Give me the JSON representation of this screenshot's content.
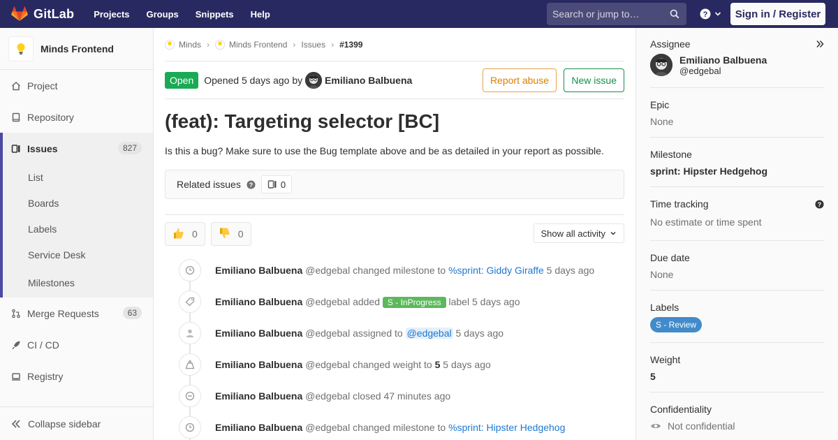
{
  "topbar": {
    "brand": "GitLab",
    "nav": [
      "Projects",
      "Groups",
      "Snippets",
      "Help"
    ],
    "search_placeholder": "Search or jump to…",
    "sign_in": "Sign in / Register",
    "brand_color": "#292961"
  },
  "sidebar": {
    "project_name": "Minds Frontend",
    "items": [
      {
        "label": "Project",
        "icon": "home-icon"
      },
      {
        "label": "Repository",
        "icon": "book-icon"
      },
      {
        "label": "Issues",
        "icon": "issues-icon",
        "badge": "827"
      },
      {
        "label": "Merge Requests",
        "icon": "merge-request-icon",
        "badge": "63"
      },
      {
        "label": "CI / CD",
        "icon": "rocket-icon"
      },
      {
        "label": "Registry",
        "icon": "container-icon"
      }
    ],
    "sub_items": [
      "List",
      "Boards",
      "Labels",
      "Service Desk",
      "Milestones"
    ],
    "collapse": "Collapse sidebar"
  },
  "breadcrumb": [
    "Minds",
    "Minds Frontend",
    "Issues",
    "#1399"
  ],
  "issue": {
    "status": "Open",
    "opened_prefix": "Opened",
    "opened_time": "5 days ago",
    "opened_by": "by",
    "author": "Emiliano Balbuena",
    "report_abuse": "Report abuse",
    "new_issue": "New issue",
    "title": "(feat): Targeting selector [BC]",
    "description": "Is this a bug? Make sure to use the Bug template above and be as detailed in your report as possible.",
    "related_label": "Related issues",
    "related_count": "0",
    "thumbs_up": "0",
    "thumbs_down": "0",
    "activity_filter": "Show all activity"
  },
  "timeline": [
    {
      "name": "Emiliano Balbuena",
      "user": "@edgebal",
      "action": "changed milestone to",
      "target": "%sprint: Giddy Giraffe",
      "time": "5 days ago",
      "icon": "clock-icon"
    },
    {
      "name": "Emiliano Balbuena",
      "user": "@edgebal",
      "action": "added",
      "label": "S - InProgress",
      "suffix": "label",
      "time": "5 days ago",
      "icon": "tag-icon"
    },
    {
      "name": "Emiliano Balbuena",
      "user": "@edgebal",
      "action": "assigned to",
      "mention": "@edgebal",
      "time": "5 days ago",
      "icon": "user-icon"
    },
    {
      "name": "Emiliano Balbuena",
      "user": "@edgebal",
      "action": "changed weight to",
      "value": "5",
      "time": "5 days ago",
      "icon": "weight-icon"
    },
    {
      "name": "Emiliano Balbuena",
      "user": "@edgebal",
      "action": "closed",
      "time": "47 minutes ago",
      "icon": "closed-icon"
    },
    {
      "name": "Emiliano Balbuena",
      "user": "@edgebal",
      "action": "changed milestone to",
      "target": "%sprint: Hipster Hedgehog",
      "time": "",
      "icon": "clock-icon"
    }
  ],
  "rsidebar": {
    "assignee_title": "Assignee",
    "assignee_name": "Emiliano Balbuena",
    "assignee_user": "@edgebal",
    "epic_title": "Epic",
    "epic_val": "None",
    "milestone_title": "Milestone",
    "milestone_val": "sprint: Hipster Hedgehog",
    "time_title": "Time tracking",
    "time_val": "No estimate or time spent",
    "due_title": "Due date",
    "due_val": "None",
    "labels_title": "Labels",
    "label_val": "S - Review",
    "weight_title": "Weight",
    "weight_val": "5",
    "conf_title": "Confidentiality",
    "conf_val": "Not confidential"
  }
}
